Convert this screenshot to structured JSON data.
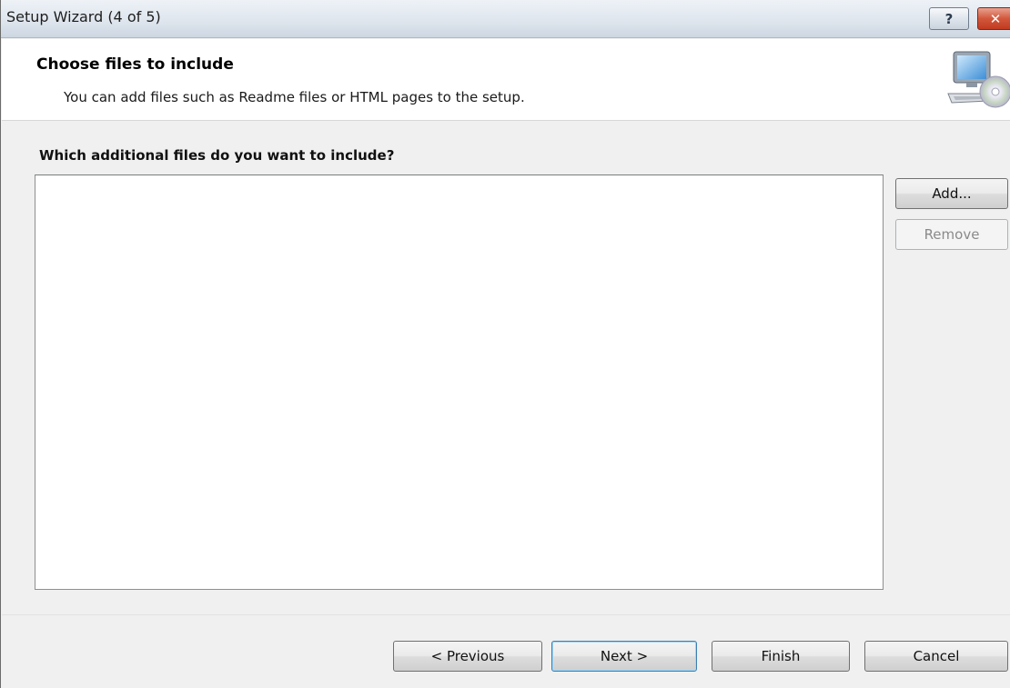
{
  "window": {
    "title": "Setup Wizard (4 of 5)",
    "help_label": "?",
    "close_label": "✕"
  },
  "header": {
    "title": "Choose files to include",
    "subtitle": "You can add files such as Readme files or HTML pages to the setup.",
    "icon": "computer-cd-icon"
  },
  "main": {
    "question": "Which additional files do you want to include?",
    "files": [],
    "add_label": "Add...",
    "remove_label": "Remove"
  },
  "footer": {
    "previous_label": "< Previous",
    "next_label": "Next >",
    "finish_label": "Finish",
    "cancel_label": "Cancel"
  },
  "colors": {
    "accent": "#3c7fb1",
    "close": "#c13b20"
  }
}
